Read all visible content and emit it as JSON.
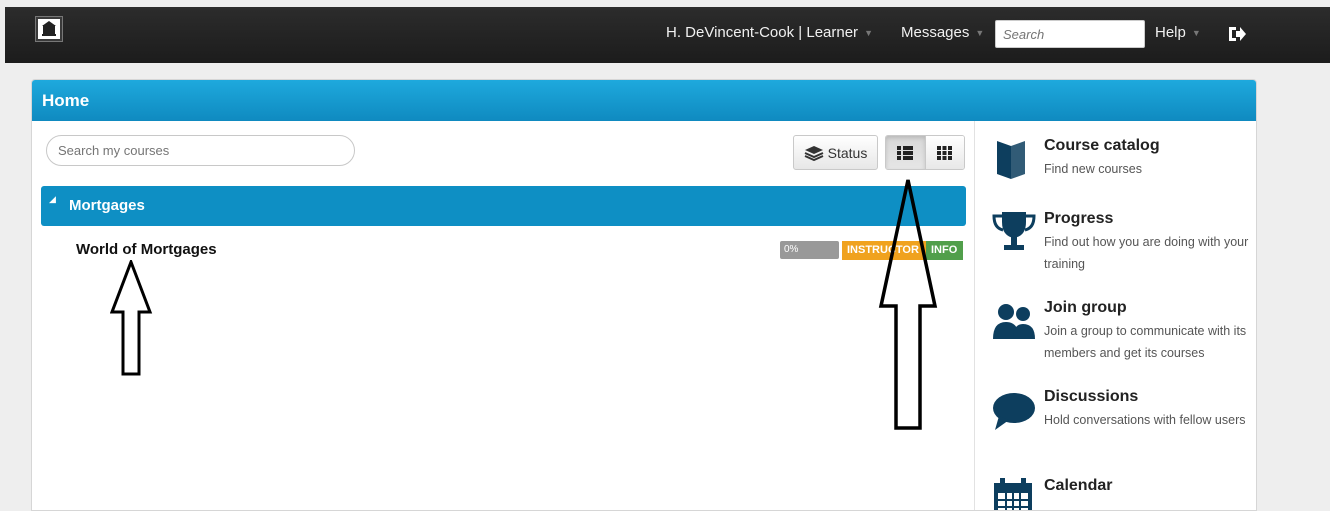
{
  "topbar": {
    "user_label": "H. DeVincent-Cook | Learner",
    "messages_label": "Messages",
    "search_placeholder": "Search",
    "help_label": "Help",
    "caret": "▼"
  },
  "home": {
    "title": "Home",
    "course_search_placeholder": "Search my courses",
    "status_button_label": "Status"
  },
  "category": {
    "toggle": "◢",
    "name": "Mortgages"
  },
  "course": {
    "name": "World of Mortgages",
    "progress_value": 0,
    "progress_text": "0%",
    "badge_instructor": "INSTRUCTOR",
    "badge_info": "INFO"
  },
  "sidebar": {
    "items": [
      {
        "title": "Course catalog",
        "desc": "Find new courses",
        "icon": "book-icon"
      },
      {
        "title": "Progress",
        "desc": "Find out how you are doing with your training",
        "icon": "trophy-icon"
      },
      {
        "title": "Join group",
        "desc": "Join a group to communicate with its members and get its courses",
        "icon": "group-icon"
      },
      {
        "title": "Discussions",
        "desc": "Hold conversations with fellow users",
        "icon": "speech-bubble-icon"
      },
      {
        "title": "Calendar",
        "desc": "",
        "icon": "calendar-icon"
      }
    ]
  },
  "colors": {
    "accent": "#0f8ac0",
    "instructor": "#f0a21e",
    "info": "#519f4b",
    "topbar": "#1c1c1c",
    "icon": "#0d3e5e"
  }
}
